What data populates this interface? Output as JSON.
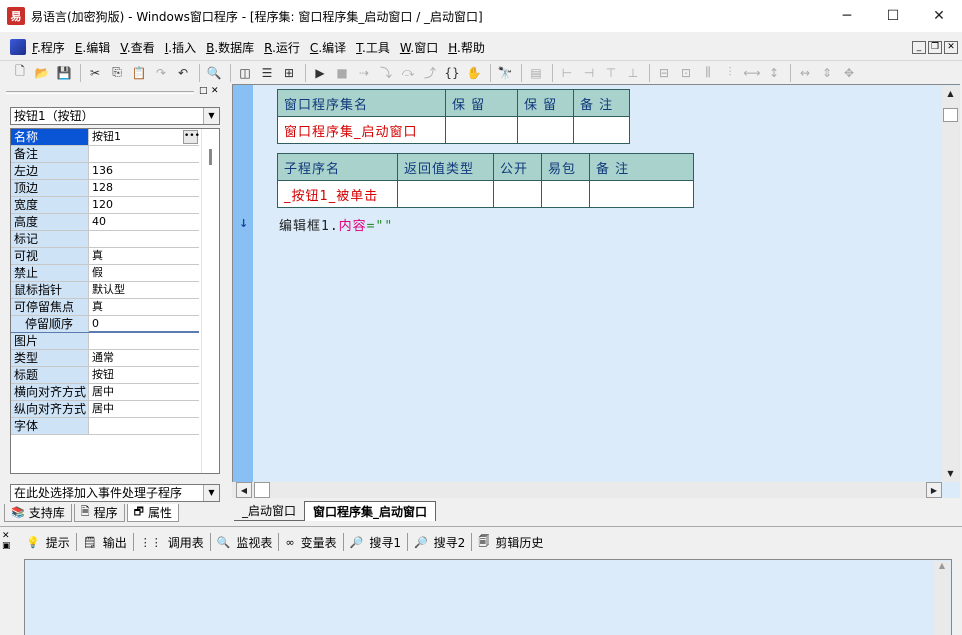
{
  "window": {
    "title": "易语言(加密狗版) - Windows窗口程序 - [程序集: 窗口程序集_启动窗口 / _启动窗口]",
    "app_icon": "yi-language-icon",
    "controls": [
      "minimize",
      "maximize",
      "close"
    ]
  },
  "menu": [
    {
      "key": "F",
      "label": ".程序"
    },
    {
      "key": "E",
      "label": ".编辑"
    },
    {
      "key": "V",
      "label": ".查看"
    },
    {
      "key": "I",
      "label": ".插入"
    },
    {
      "key": "B",
      "label": ".数据库"
    },
    {
      "key": "R",
      "label": ".运行"
    },
    {
      "key": "C",
      "label": ".编译"
    },
    {
      "key": "T",
      "label": ".工具"
    },
    {
      "key": "W",
      "label": ".窗口"
    },
    {
      "key": "H",
      "label": ".帮助"
    }
  ],
  "left_panel": {
    "object_selector": "按钮1（按钮）",
    "properties": [
      {
        "name": "名称",
        "value": "按钮1"
      },
      {
        "name": "备注",
        "value": ""
      },
      {
        "name": "左边",
        "value": "136"
      },
      {
        "name": "顶边",
        "value": "128"
      },
      {
        "name": "宽度",
        "value": "120"
      },
      {
        "name": "高度",
        "value": "40"
      },
      {
        "name": "标记",
        "value": ""
      },
      {
        "name": "可视",
        "value": "真"
      },
      {
        "name": "禁止",
        "value": "假"
      },
      {
        "name": "鼠标指针",
        "value": "默认型"
      },
      {
        "name": "可停留焦点",
        "value": "真"
      },
      {
        "name": "停留顺序",
        "value": "0"
      },
      {
        "name": "图片",
        "value": ""
      },
      {
        "name": "类型",
        "value": "通常"
      },
      {
        "name": "标题",
        "value": "按钮"
      },
      {
        "name": "横向对齐方式",
        "value": "居中"
      },
      {
        "name": "纵向对齐方式",
        "value": "居中"
      },
      {
        "name": "字体",
        "value": ""
      }
    ],
    "event_selector": "在此处选择加入事件处理子程序",
    "tabs": [
      {
        "label": "支持库",
        "icon": "library-icon"
      },
      {
        "label": "程序",
        "icon": "program-icon"
      },
      {
        "label": "属性",
        "icon": "property-icon"
      }
    ]
  },
  "editor": {
    "assembly_table": {
      "headers": [
        "窗口程序集名",
        "保 留",
        "保 留",
        "备 注"
      ],
      "row": [
        "窗口程序集_启动窗口",
        "",
        "",
        ""
      ]
    },
    "sub_table": {
      "headers": [
        "子程序名",
        "返回值类型",
        "公开",
        "易包",
        "备 注"
      ],
      "row": [
        "_按钮1_被单击",
        "",
        "",
        "",
        ""
      ]
    },
    "code_line": {
      "object": "编辑框1.",
      "property": "内容",
      "op": "=",
      "string": "\"\""
    },
    "doc_tabs": [
      "_启动窗口",
      "窗口程序集_启动窗口"
    ]
  },
  "bottom_panel": {
    "tabs": [
      {
        "label": "提示",
        "icon": "hint-icon"
      },
      {
        "label": "输出",
        "icon": "output-icon"
      },
      {
        "label": "调用表",
        "icon": "call-table-icon"
      },
      {
        "label": "监视表",
        "icon": "watch-icon"
      },
      {
        "label": "变量表",
        "icon": "variable-icon"
      },
      {
        "label": "搜寻1",
        "icon": "search-icon"
      },
      {
        "label": "搜寻2",
        "icon": "search-icon"
      },
      {
        "label": "剪辑历史",
        "icon": "clipboard-history-icon"
      }
    ]
  }
}
